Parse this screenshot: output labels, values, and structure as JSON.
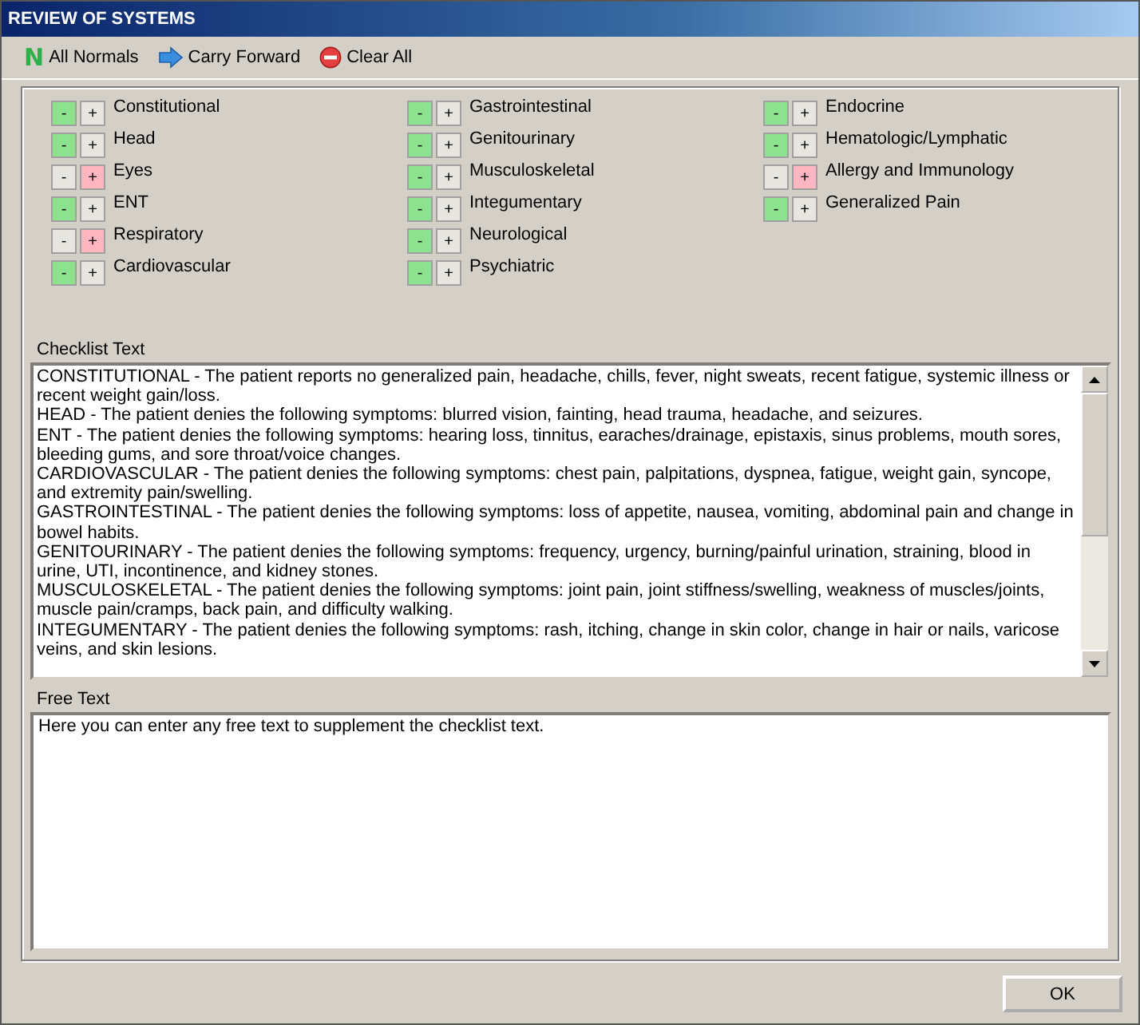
{
  "window": {
    "title": "REVIEW OF SYSTEMS"
  },
  "toolbar": [
    {
      "kind": "normals",
      "glyph": "N",
      "label": "All Normals"
    },
    {
      "kind": "forward",
      "label": "Carry Forward"
    },
    {
      "kind": "clear",
      "label": "Clear All"
    }
  ],
  "systems": [
    [
      {
        "name": "Constitutional",
        "minus": {
          "label": "-",
          "selected": true
        },
        "plus": {
          "label": "+",
          "selected": false
        }
      },
      {
        "name": "Head",
        "minus": {
          "label": "-",
          "selected": true
        },
        "plus": {
          "label": "+",
          "selected": false
        }
      },
      {
        "name": "Eyes",
        "minus": {
          "label": "-",
          "selected": false
        },
        "plus": {
          "label": "+",
          "selected": true
        }
      },
      {
        "name": "ENT",
        "minus": {
          "label": "-",
          "selected": true
        },
        "plus": {
          "label": "+",
          "selected": false
        }
      },
      {
        "name": "Respiratory",
        "minus": {
          "label": "-",
          "selected": false
        },
        "plus": {
          "label": "+",
          "selected": true
        }
      },
      {
        "name": "Cardiovascular",
        "minus": {
          "label": "-",
          "selected": true
        },
        "plus": {
          "label": "+",
          "selected": false
        }
      }
    ],
    [
      {
        "name": "Gastrointestinal",
        "minus": {
          "label": "-",
          "selected": true
        },
        "plus": {
          "label": "+",
          "selected": false
        }
      },
      {
        "name": "Genitourinary",
        "minus": {
          "label": "-",
          "selected": true
        },
        "plus": {
          "label": "+",
          "selected": false
        }
      },
      {
        "name": "Musculoskeletal",
        "minus": {
          "label": "-",
          "selected": true
        },
        "plus": {
          "label": "+",
          "selected": false
        }
      },
      {
        "name": "Integumentary",
        "minus": {
          "label": "-",
          "selected": true
        },
        "plus": {
          "label": "+",
          "selected": false
        }
      },
      {
        "name": "Neurological",
        "minus": {
          "label": "-",
          "selected": true
        },
        "plus": {
          "label": "+",
          "selected": false
        }
      },
      {
        "name": "Psychiatric",
        "minus": {
          "label": "-",
          "selected": true
        },
        "plus": {
          "label": "+",
          "selected": false
        }
      }
    ],
    [
      {
        "name": "Endocrine",
        "minus": {
          "label": "-",
          "selected": true
        },
        "plus": {
          "label": "+",
          "selected": false
        }
      },
      {
        "name": "Hematologic/Lymphatic",
        "minus": {
          "label": "-",
          "selected": true
        },
        "plus": {
          "label": "+",
          "selected": false
        }
      },
      {
        "name": "Allergy and Immunology",
        "minus": {
          "label": "-",
          "selected": false
        },
        "plus": {
          "label": "+",
          "selected": true
        }
      },
      {
        "name": "Generalized Pain",
        "minus": {
          "label": "-",
          "selected": true
        },
        "plus": {
          "label": "+",
          "selected": false
        }
      }
    ]
  ],
  "checklist": {
    "label": "Checklist Text",
    "paragraphs": [
      "CONSTITUTIONAL - The patient reports no generalized pain, headache, chills, fever, night sweats, recent fatigue, systemic illness or recent weight gain/loss.",
      "HEAD - The patient denies the following symptoms: blurred vision, fainting, head trauma, headache, and seizures.",
      "ENT - The patient denies the following symptoms: hearing loss, tinnitus, earaches/drainage, epistaxis, sinus problems, mouth sores, bleeding gums, and sore throat/voice changes.",
      "CARDIOVASCULAR - The patient denies the following symptoms: chest pain, palpitations, dyspnea, fatigue, weight gain, syncope, and extremity pain/swelling.",
      "GASTROINTESTINAL - The patient denies the following symptoms: loss of appetite, nausea, vomiting, abdominal pain and change in bowel habits.",
      "GENITOURINARY - The patient denies the following symptoms: frequency, urgency, burning/painful urination, straining, blood in urine, UTI, incontinence, and kidney stones.",
      "MUSCULOSKELETAL - The patient denies the following symptoms: joint pain, joint stiffness/swelling, weakness of muscles/joints, muscle pain/cramps, back pain, and difficulty walking.",
      "INTEGUMENTARY - The patient denies the following symptoms: rash, itching, change in skin color, change in hair or nails, varicose veins, and skin lesions."
    ]
  },
  "free_text": {
    "label": "Free Text",
    "value": "Here you can enter any free text to supplement the checklist text."
  },
  "ok_button": "OK"
}
